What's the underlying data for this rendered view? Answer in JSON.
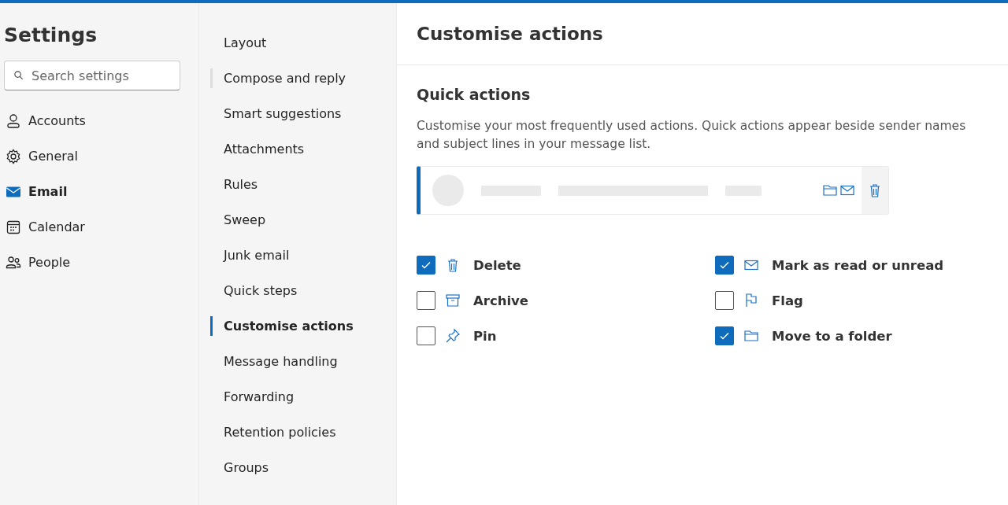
{
  "sidebar": {
    "title": "Settings",
    "search": {
      "placeholder": "Search settings"
    },
    "items": [
      {
        "kind": "person",
        "label": "Accounts",
        "selected": false
      },
      {
        "kind": "gear",
        "label": "General",
        "selected": false
      },
      {
        "kind": "mail",
        "label": "Email",
        "selected": true
      },
      {
        "kind": "calendar",
        "label": "Calendar",
        "selected": false
      },
      {
        "kind": "people",
        "label": "People",
        "selected": false
      }
    ]
  },
  "subnav": {
    "items": [
      {
        "label": "Layout",
        "selected": false,
        "hovered": false
      },
      {
        "label": "Compose and reply",
        "selected": false,
        "hovered": true
      },
      {
        "label": "Smart suggestions",
        "selected": false,
        "hovered": false
      },
      {
        "label": "Attachments",
        "selected": false,
        "hovered": false
      },
      {
        "label": "Rules",
        "selected": false,
        "hovered": false
      },
      {
        "label": "Sweep",
        "selected": false,
        "hovered": false
      },
      {
        "label": "Junk email",
        "selected": false,
        "hovered": false
      },
      {
        "label": "Quick steps",
        "selected": false,
        "hovered": false
      },
      {
        "label": "Customise actions",
        "selected": true,
        "hovered": false
      },
      {
        "label": "Message handling",
        "selected": false,
        "hovered": false
      },
      {
        "label": "Forwarding",
        "selected": false,
        "hovered": false
      },
      {
        "label": "Retention policies",
        "selected": false,
        "hovered": false
      },
      {
        "label": "Groups",
        "selected": false,
        "hovered": false
      }
    ]
  },
  "content": {
    "title": "Customise actions",
    "section": {
      "heading": "Quick actions",
      "description": "Customise your most frequently used actions. Quick actions appear beside sender names and subject lines in your message list.",
      "preview": {
        "hover_icons": [
          {
            "kind": "folder"
          },
          {
            "kind": "mail"
          }
        ],
        "end_icon": {
          "kind": "delete"
        }
      },
      "actions": [
        {
          "kind": "delete",
          "label": "Delete",
          "checked": true
        },
        {
          "kind": "mail",
          "label": "Mark as read or unread",
          "checked": true
        },
        {
          "kind": "archive",
          "label": "Archive",
          "checked": false
        },
        {
          "kind": "flag",
          "label": "Flag",
          "checked": false
        },
        {
          "kind": "pin",
          "label": "Pin",
          "checked": false
        },
        {
          "kind": "folder",
          "label": "Move to a folder",
          "checked": true
        }
      ]
    }
  }
}
